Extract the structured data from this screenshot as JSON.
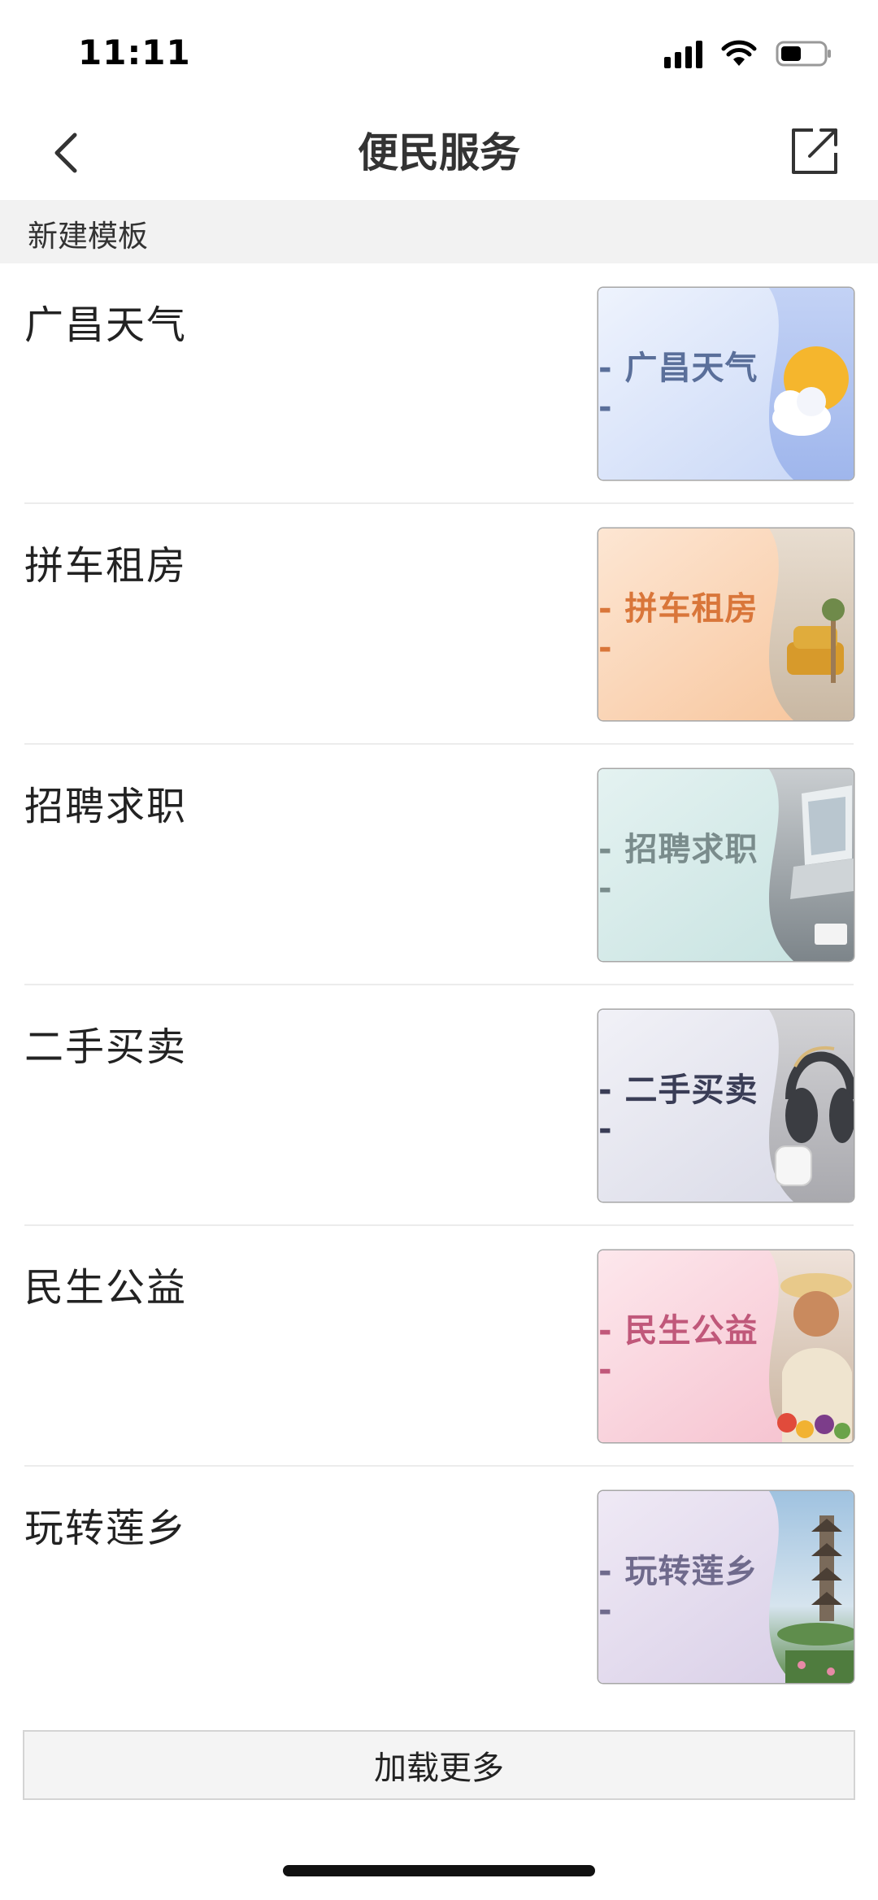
{
  "status_bar": {
    "time": "11:11"
  },
  "nav": {
    "title": "便民服务"
  },
  "section": {
    "label": "新建模板"
  },
  "items": [
    {
      "title": "广昌天气",
      "thumb_label": "- 广昌天气 -",
      "label_color": "#5a6f9a"
    },
    {
      "title": "拼车租房",
      "thumb_label": "- 拼车租房 -",
      "label_color": "#d9763a"
    },
    {
      "title": "招聘求职",
      "thumb_label": "- 招聘求职 -",
      "label_color": "#7a8c8c"
    },
    {
      "title": "二手买卖",
      "thumb_label": "- 二手买卖 -",
      "label_color": "#3a3d56"
    },
    {
      "title": "民生公益",
      "thumb_label": "- 民生公益 -",
      "label_color": "#c0587a"
    },
    {
      "title": "玩转莲乡",
      "thumb_label": "- 玩转莲乡 -",
      "label_color": "#6f6a8c"
    }
  ],
  "load_more": {
    "label": "加载更多"
  }
}
